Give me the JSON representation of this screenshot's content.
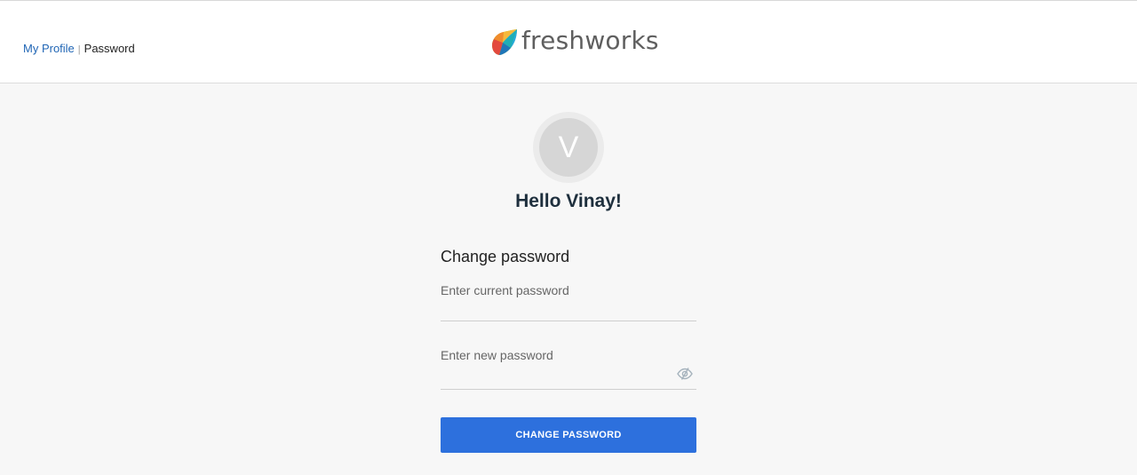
{
  "breadcrumb": {
    "items": [
      {
        "label": "My Profile"
      },
      {
        "label": "Password"
      }
    ],
    "separator": "|"
  },
  "logo": {
    "text": "freshworks",
    "icon": "freshworks-logo-icon"
  },
  "profile": {
    "avatar_initial": "V",
    "greeting": "Hello Vinay!"
  },
  "form": {
    "title": "Change password",
    "current_password_label": "Enter current password",
    "current_password_value": "",
    "new_password_label": "Enter new password",
    "new_password_value": "",
    "toggle_visibility_icon": "eye-slash-icon",
    "submit_label": "CHANGE PASSWORD"
  },
  "colors": {
    "primary": "#2d70dd",
    "link": "#2166b5",
    "heading": "#1e2f3d",
    "background": "#f7f7f7"
  }
}
